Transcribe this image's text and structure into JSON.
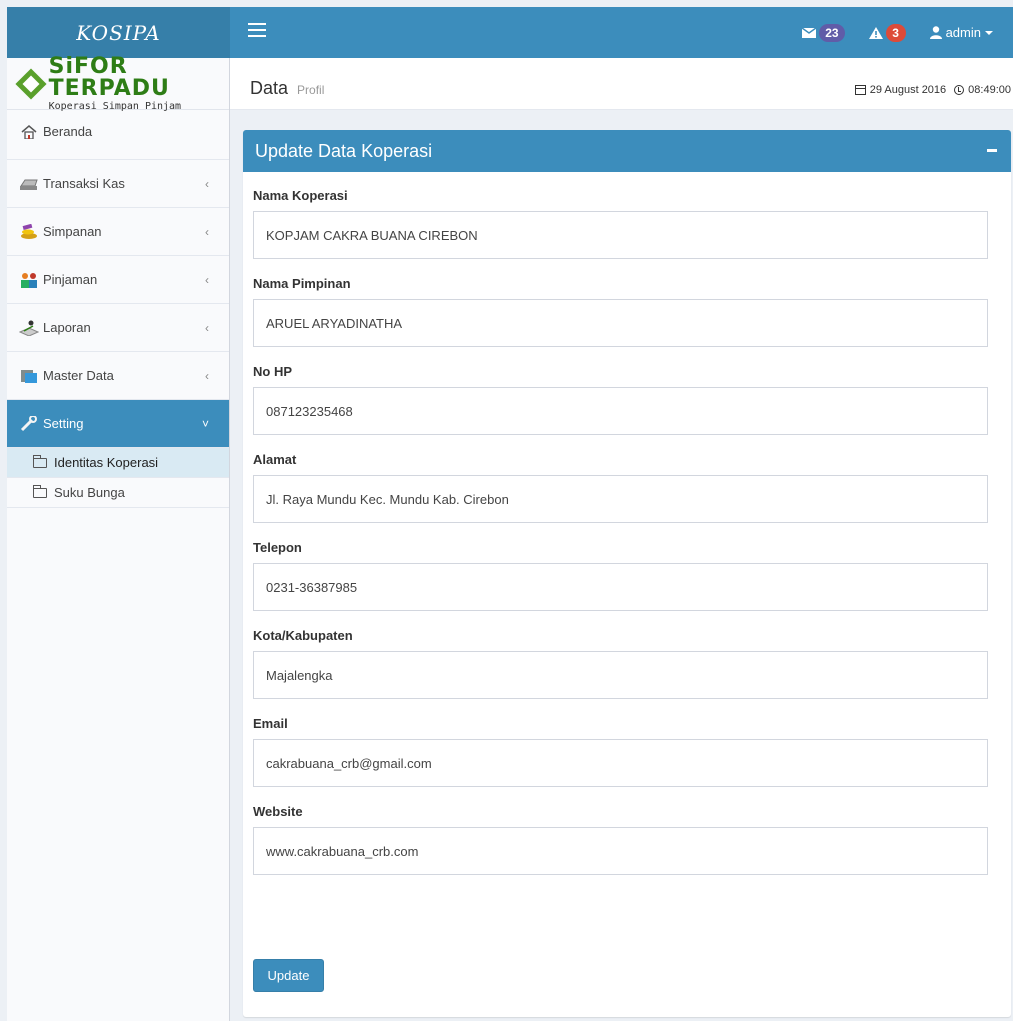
{
  "app": {
    "logo": "KOSIPA"
  },
  "brand": {
    "title": "SiFOR TERPADU",
    "subtitle": "Koperasi Simpan Pinjam"
  },
  "navbar": {
    "messages_count": "23",
    "alerts_count": "3",
    "user_label": "admin"
  },
  "sidebar": {
    "items": [
      {
        "label": "Beranda",
        "icon": "home-icon"
      },
      {
        "label": "Transaksi Kas",
        "icon": "cash-register-icon"
      },
      {
        "label": "Simpanan",
        "icon": "savings-icon"
      },
      {
        "label": "Pinjaman",
        "icon": "people-icon"
      },
      {
        "label": "Laporan",
        "icon": "report-icon"
      },
      {
        "label": "Master Data",
        "icon": "database-icon"
      },
      {
        "label": "Setting",
        "icon": "wrench-icon"
      }
    ],
    "submenu": [
      {
        "label": "Identitas Koperasi"
      },
      {
        "label": "Suku Bunga"
      }
    ]
  },
  "header": {
    "title": "Data",
    "subtitle": "Profil",
    "date": "29 August 2016",
    "time": "08:49:00"
  },
  "form": {
    "title": "Update Data Koperasi",
    "fields": [
      {
        "label": "Nama Koperasi",
        "value": "KOPJAM CAKRA BUANA CIREBON"
      },
      {
        "label": "Nama Pimpinan",
        "value": "ARUEL ARYADINATHA"
      },
      {
        "label": "No HP",
        "value": "087123235468"
      },
      {
        "label": "Alamat",
        "value": "Jl. Raya Mundu Kec. Mundu Kab. Cirebon"
      },
      {
        "label": "Telepon",
        "value": "0231-36387985"
      },
      {
        "label": "Kota/Kabupaten",
        "value": "Majalengka"
      },
      {
        "label": "Email",
        "value": "cakrabuana_crb@gmail.com"
      },
      {
        "label": "Website",
        "value": "www.cakrabuana_crb.com"
      }
    ],
    "submit_label": "Update"
  },
  "colors": {
    "primary": "#3c8dbc",
    "primary_dark": "#367fa9",
    "badge_purple": "#605ca8",
    "badge_red": "#dd4b39"
  }
}
